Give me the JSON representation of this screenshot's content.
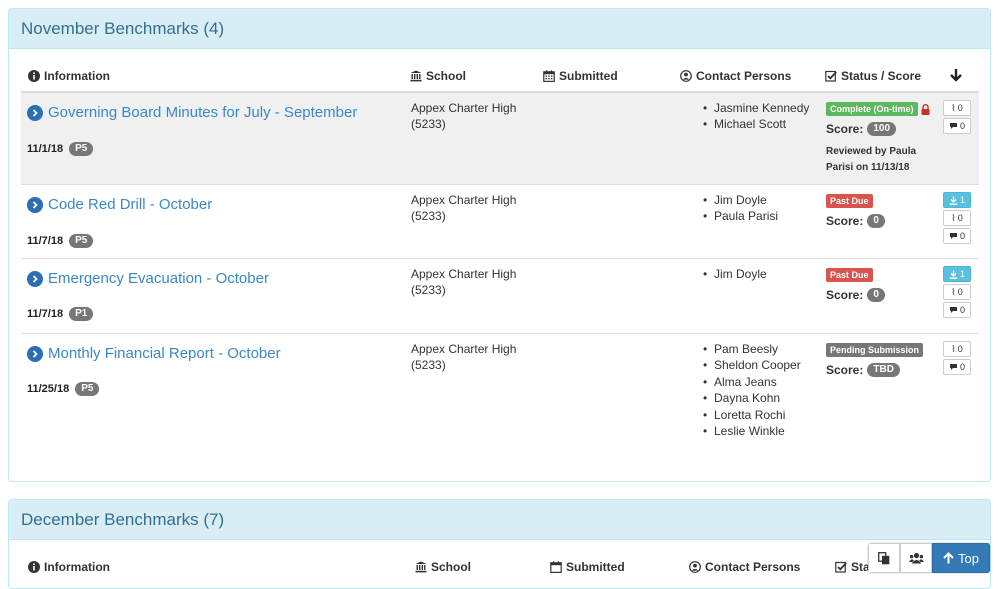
{
  "sections": [
    {
      "title": "November Benchmarks",
      "count": "(4)",
      "headers": {
        "information": "Information",
        "school": "School",
        "submitted": "Submitted",
        "contacts": "Contact Persons",
        "status": "Status / Score"
      },
      "rows": [
        {
          "title": "Governing Board Minutes for July - September",
          "date": "11/1/18",
          "priority": "P5",
          "school": "Appex Charter High",
          "school_code": "(5233)",
          "contacts": [
            "Jasmine Kennedy",
            "Michael Scott"
          ],
          "status": "Complete (On-time)",
          "status_color": "#5cb85c",
          "score_label": "Score:",
          "score": "100",
          "reviewed": "Reviewed by Paula Parisi on 11/13/18",
          "attachments": "0",
          "comments": "0"
        },
        {
          "title": "Code Red Drill - October",
          "date": "11/7/18",
          "priority": "P5",
          "school": "Appex Charter High",
          "school_code": "(5233)",
          "contacts": [
            "Jim Doyle",
            "Paula Parisi"
          ],
          "status": "Past Due",
          "status_color": "#d9534f",
          "score_label": "Score:",
          "score": "0",
          "uploads": "1",
          "attachments": "0",
          "comments": "0"
        },
        {
          "title": "Emergency Evacuation - October",
          "date": "11/7/18",
          "priority": "P1",
          "school": "Appex Charter High",
          "school_code": "(5233)",
          "contacts": [
            "Jim Doyle"
          ],
          "status": "Past Due",
          "status_color": "#d9534f",
          "score_label": "Score:",
          "score": "0",
          "uploads": "1",
          "attachments": "0",
          "comments": "0"
        },
        {
          "title": "Monthly Financial Report - October",
          "date": "11/25/18",
          "priority": "P5",
          "school": "Appex Charter High",
          "school_code": "(5233)",
          "contacts": [
            "Pam Beesly",
            "Sheldon Cooper",
            "Alma Jeans",
            "Dayna Kohn",
            "Loretta Rochi",
            "Leslie Winkle"
          ],
          "status": "Pending Submission",
          "status_color": "#777777",
          "score_label": "Score:",
          "score": "TBD",
          "attachments": "0",
          "comments": "0"
        }
      ]
    },
    {
      "title": "December Benchmarks",
      "count": "(7)",
      "headers": {
        "information": "Information",
        "school": "School",
        "submitted": "Submitted",
        "contacts": "Contact Persons",
        "status": "Stat"
      }
    }
  ],
  "floating_toolbar": {
    "top_label": "Top",
    "icons": [
      "copy-icon",
      "users-icon",
      "arrow-up-icon"
    ]
  }
}
